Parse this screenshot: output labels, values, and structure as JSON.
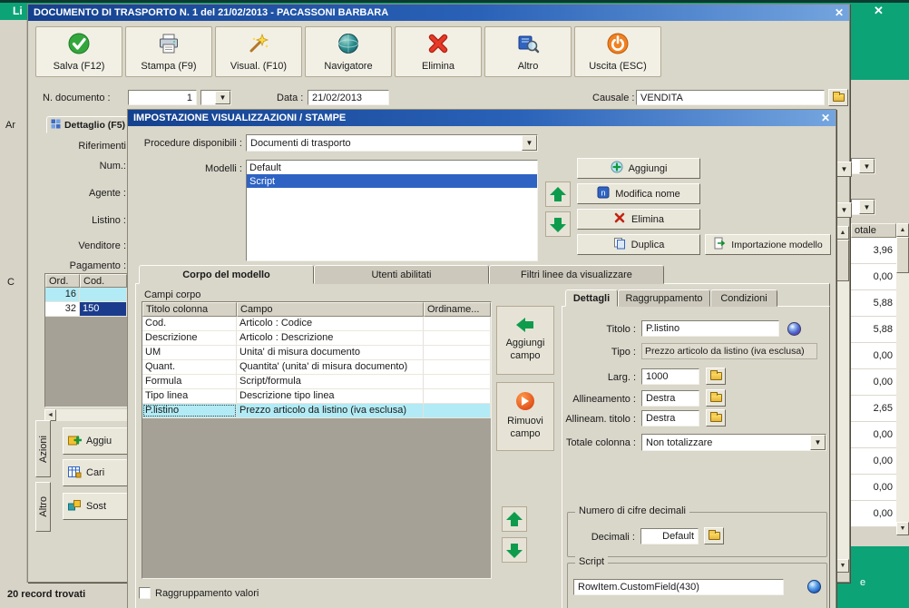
{
  "icons": {
    "close": "✕",
    "up": "▲",
    "down": "▼",
    "left": "◄",
    "combo": "▼",
    "rename_letter": "n"
  },
  "background": {
    "window_title_fragment": "Li",
    "left_fragments": [
      "Ar",
      "C"
    ],
    "status_text": "20 record trovati",
    "bottom_right_fragment": "e",
    "right_grid": {
      "header_fragment": "otale",
      "values": [
        "3,96",
        "0,00",
        "5,88",
        "5,88",
        "0,00",
        "0,00",
        "2,65",
        "0,00",
        "0,00",
        "0,00",
        "0,00"
      ]
    }
  },
  "main_window": {
    "title": "DOCUMENTO DI TRASPORTO N. 1 del 21/02/2013 - PACASSONI BARBARA",
    "toolbar": [
      {
        "label": "Salva (F12)"
      },
      {
        "label": "Stampa (F9)"
      },
      {
        "label": "Visual. (F10)"
      },
      {
        "label": "Navigatore"
      },
      {
        "label": "Elimina"
      },
      {
        "label": "Altro"
      },
      {
        "label": "Uscita (ESC)"
      }
    ],
    "fields": {
      "n_documento_label": "N. documento :",
      "n_documento_value": "1",
      "data_label": "Data :",
      "data_value": "21/02/2013",
      "causale_label": "Causale :",
      "causale_value": "VENDITA"
    },
    "dettaglio_tab": "Dettaglio (F5)",
    "left_labels": [
      "Riferimenti",
      "Num.:",
      "Agente :",
      "Listino :",
      "Venditore :",
      "Pagamento :"
    ],
    "items_grid": {
      "headers": [
        "Ord.",
        "Cod."
      ],
      "rows": [
        [
          "16",
          ""
        ],
        [
          "32",
          "150"
        ]
      ]
    },
    "side_tabs": [
      "Azioni",
      "Altro"
    ],
    "side_buttons": [
      "Aggiu",
      "Cari",
      "Sost"
    ]
  },
  "dialog": {
    "title": "IMPOSTAZIONE VISUALIZZAZIONI / STAMPE",
    "procedure": {
      "label": "Procedure disponibili :",
      "value": "Documenti di trasporto"
    },
    "modelli": {
      "label": "Modelli :",
      "items": [
        "Default",
        "Script"
      ],
      "selected": "Script"
    },
    "model_butt": {
      "aggiungi": "Aggiungi",
      "modifica_nome": "Modifica nome",
      "elimina": "Elimina",
      "duplica": "Duplica",
      "importazione": "Importazione modello"
    },
    "tabs": [
      "Corpo del modello",
      "Utenti abilitati",
      "Filtri linee da visualizzare"
    ],
    "campi_corpo_label": "Campi corpo",
    "table": {
      "headers": [
        "Titolo colonna",
        "Campo",
        "Ordiname..."
      ],
      "rows": [
        [
          "Cod.",
          "Articolo : Codice"
        ],
        [
          "Descrizione",
          "Articolo : Descrizione"
        ],
        [
          "UM",
          "Unita' di misura documento"
        ],
        [
          "Quant.",
          "Quantita' (unita' di misura documento)"
        ],
        [
          "Formula",
          "Script/formula"
        ],
        [
          "Tipo linea",
          "Descrizione tipo linea"
        ],
        [
          "P.listino",
          "Prezzo articolo da listino (iva esclusa)"
        ]
      ],
      "selected_row": "P.listino"
    },
    "transfer": {
      "add": "Aggiungi campo",
      "remove": "Rimuovi campo"
    },
    "detail_tabs": [
      "Dettagli",
      "Raggruppamento",
      "Condizioni"
    ],
    "details": {
      "titolo": {
        "label": "Titolo :",
        "value": "P.listino"
      },
      "tipo": {
        "label": "Tipo :",
        "value": "Prezzo articolo da listino (iva esclusa)"
      },
      "larg": {
        "label": "Larg. :",
        "value": "1000"
      },
      "allineamento": {
        "label": "Allineamento :",
        "value": "Destra"
      },
      "allineam_titolo": {
        "label": "Allineam. titolo :",
        "value": "Destra"
      },
      "totale_colonna": {
        "label": "Totale colonna :",
        "value": "Non totalizzare"
      },
      "decimali_group": "Numero di cifre decimali",
      "decimali": {
        "label": "Decimali :",
        "value": "Default"
      },
      "script_group": "Script",
      "script_value": "RowItem.CustomField(430)"
    },
    "raggruppamento_checkbox": "Raggruppamento valori"
  }
}
